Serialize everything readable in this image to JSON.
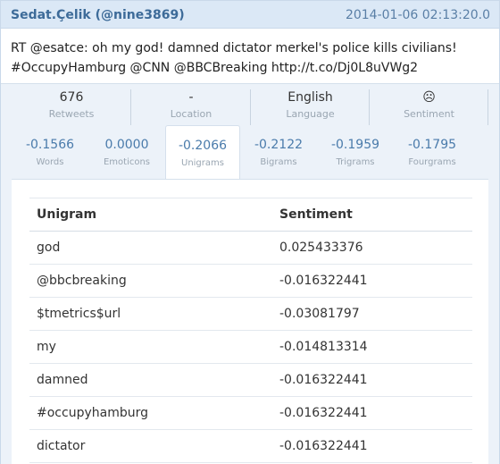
{
  "header": {
    "user": "Sedat.Çelik (@nine3869)",
    "date": "2014-01-06 02:13:20.0"
  },
  "tweet": {
    "line1": "RT @esatce: oh my god! damned dictator merkel's police kills civilians!",
    "line2": "#OccupyHamburg @CNN @BBCBreaking http://t.co/Dj0L8uVWg2"
  },
  "stats": [
    {
      "value": "676",
      "label": "Retweets"
    },
    {
      "value": "-",
      "label": "Location"
    },
    {
      "value": "English",
      "label": "Language"
    },
    {
      "value": "☹",
      "label": "Sentiment",
      "icon": "sad-face-icon"
    }
  ],
  "tabs": [
    {
      "value": "-0.1566",
      "label": "Words"
    },
    {
      "value": "0.0000",
      "label": "Emoticons"
    },
    {
      "value": "-0.2066",
      "label": "Unigrams",
      "active": true
    },
    {
      "value": "-0.2122",
      "label": "Bigrams"
    },
    {
      "value": "-0.1959",
      "label": "Trigrams"
    },
    {
      "value": "-0.1795",
      "label": "Fourgrams"
    }
  ],
  "table": {
    "columns": [
      "Unigram",
      "Sentiment"
    ],
    "rows": [
      [
        "god",
        "0.025433376"
      ],
      [
        "@bbcbreaking",
        "-0.016322441"
      ],
      [
        "$tmetrics$url",
        "-0.03081797"
      ],
      [
        "my",
        "-0.014813314"
      ],
      [
        "damned",
        "-0.016322441"
      ],
      [
        "#occupyhamburg",
        "-0.016322441"
      ],
      [
        "dictator",
        "-0.016322441"
      ]
    ]
  },
  "colors": {
    "header_bg": "#dbe8f6",
    "user": "#3d6b99",
    "tab_value": "#4a7bab",
    "stats_bg": "#ecf2f9"
  }
}
